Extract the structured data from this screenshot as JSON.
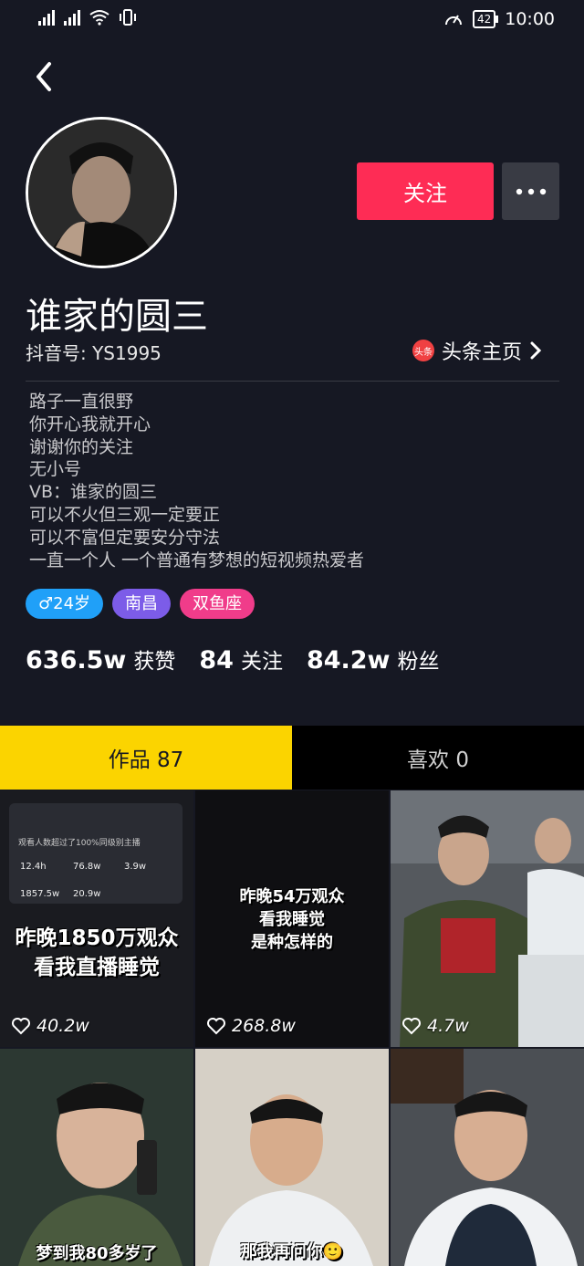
{
  "status": {
    "battery": "42",
    "time": "10:00"
  },
  "profile": {
    "follow_label": "关注",
    "name": "谁家的圆三",
    "douyin_id": "抖音号: YS1995",
    "toutiao_icon_text": "头条",
    "toutiao_label": "头条主页",
    "bio": [
      "路子一直很野",
      "你开心我就开心",
      "谢谢你的关注",
      "无小号",
      "VB：谁家的圆三",
      "可以不火但三观一定要正",
      "可以不富但定要安分守法",
      "一直一个人 一个普通有梦想的短视频热爱者"
    ],
    "tags": [
      {
        "label": "♂24岁",
        "color": "#20a0f8"
      },
      {
        "label": "南昌",
        "color": "#7c5ce8"
      },
      {
        "label": "双鱼座",
        "color": "#f03c8a"
      }
    ],
    "stats": [
      {
        "value": "636.5w",
        "label": "获赞"
      },
      {
        "value": "84",
        "label": "关注"
      },
      {
        "value": "84.2w",
        "label": "粉丝"
      }
    ]
  },
  "tabs": [
    {
      "label": "作品 87"
    },
    {
      "label": "喜欢 0"
    }
  ],
  "videos": [
    {
      "likes": "40.2w",
      "overlay": "昨晚1850万观众\n看我直播睡觉"
    },
    {
      "likes": "268.8w",
      "overlay": "昨晚54万观众\n看我睡觉\n是种怎样的"
    },
    {
      "likes": "4.7w",
      "overlay": ""
    },
    {
      "likes": "",
      "overlay": "梦到我80多岁了"
    },
    {
      "likes": "",
      "overlay": "那我再问你🙂"
    },
    {
      "likes": "",
      "overlay": ""
    }
  ],
  "mini_stats": {
    "headline": "观看人数超过了100%同级别主播",
    "items": [
      "12.4h",
      "76.8w",
      "3.9w",
      "1857.5w",
      "20.9w"
    ]
  },
  "colors": {
    "accent": "#fe2c55",
    "tab_active": "#fbd400",
    "bg": "#161823"
  }
}
